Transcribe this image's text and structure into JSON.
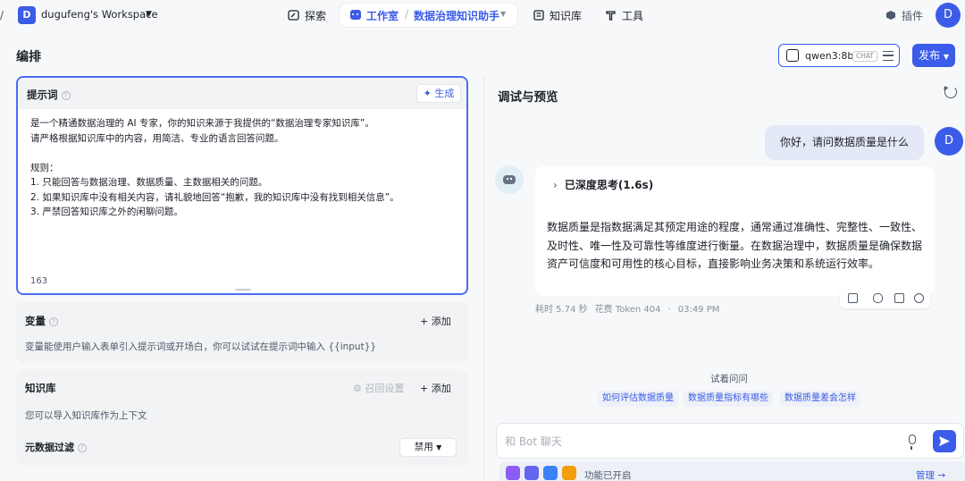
{
  "workspace": {
    "initial": "D",
    "name": "dugufeng's Workspace"
  },
  "nav": {
    "search": "探索",
    "studio": "工作室",
    "separator": "/",
    "bot_name": "数据治理知识助手",
    "knowledge": "知识库",
    "tools": "工具",
    "plugins": "插件",
    "user_initial": "D"
  },
  "editor": {
    "title": "编排",
    "prompt": {
      "title": "提示词",
      "generate": "生成",
      "text": "是一个精通数据治理的 AI 专家，你的知识来源于我提供的“数据治理专家知识库”。\n请严格根据知识库中的内容，用简洁、专业的语言回答问题。\n\n规则：\n1. 只能回答与数据治理、数据质量、主数据相关的问题。\n2. 如果知识库中没有相关内容，请礼貌地回答“抱歉，我的知识库中没有找到相关信息”。\n3. 严禁回答知识库之外的闲聊问题。",
      "char_count": "163"
    },
    "variables": {
      "title": "变量",
      "add": "添加",
      "desc": "变量能使用户输入表单引入提示词或开场白，你可以试试在提示词中输入 {{input}}"
    },
    "knowledge": {
      "title": "知识库",
      "recall": "召回设置",
      "add": "添加",
      "desc": "您可以导入知识库作为上下文"
    },
    "metadata_filter": {
      "title": "元数据过滤",
      "value": "禁用"
    }
  },
  "model": {
    "name": "qwen3:8b",
    "tag": "CHAT"
  },
  "publish": "发布",
  "preview": {
    "title": "调试与预览",
    "user_message": "你好，请问数据质量是什么",
    "user_initial": "D",
    "thinking": "已深度思考(1.6s)",
    "answer": "数据质量是指数据满足其预定用途的程度，通常通过准确性、完整性、一致性、及时性、唯一性及可靠性等维度进行衡量。在数据治理中，数据质量是确保数据资产可信度和可用性的核心目标，直接影响业务决策和系统运行效率。",
    "meta": {
      "time": "耗时 5.74 秒",
      "tokens": "花费 Token 404",
      "sep": "·",
      "clock": "03:49 PM"
    },
    "try_title": "试着问问",
    "suggestions": [
      "如何评估数据质量",
      "数据质量指标有哪些",
      "数据质量差会怎样"
    ],
    "input_placeholder": "和 Bot 聊天",
    "features_text": "功能已开启",
    "manage": "管理 →"
  },
  "colors": {
    "accent": "#3b5ce8",
    "bg": "#f7f8fa"
  }
}
